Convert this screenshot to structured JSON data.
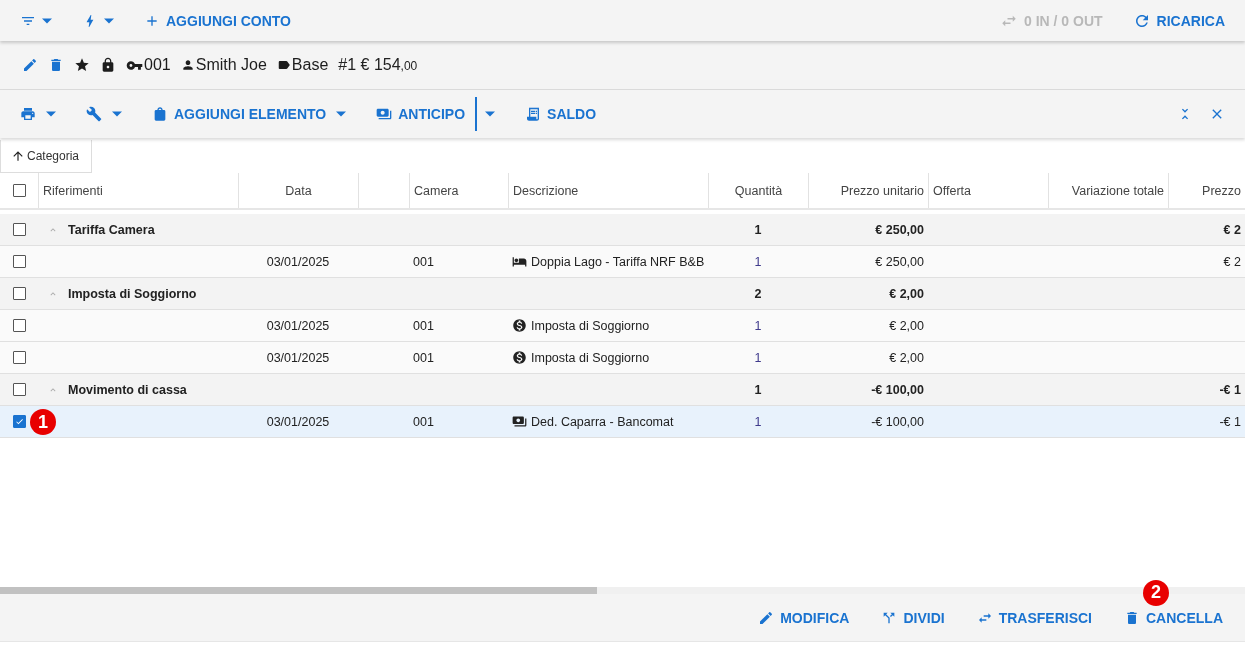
{
  "top_bar": {
    "left": [
      {
        "kind": "filter",
        "caret": true
      },
      {
        "kind": "bolt",
        "caret": true
      },
      {
        "kind": "plus",
        "label": "AGGIUNGI CONTO"
      }
    ],
    "right": [
      {
        "kind": "swap",
        "label": "0 IN / 0 OUT",
        "disabled": true
      },
      {
        "kind": "refresh",
        "label": "RICARICA",
        "disabled": false
      }
    ]
  },
  "info_bar": {
    "actions": [
      {
        "kind": "pencil"
      },
      {
        "kind": "trash"
      }
    ],
    "flags": [
      {
        "kind": "star"
      },
      {
        "kind": "lock"
      }
    ],
    "facts": [
      {
        "kind": "key",
        "text": "001"
      },
      {
        "kind": "person",
        "text": "Smith Joe"
      },
      {
        "kind": "tag",
        "text": "Base"
      }
    ],
    "amount": "#1 € 154",
    "decimals": ",00"
  },
  "toolbar": {
    "left": [
      {
        "kind": "printer",
        "caret": true
      },
      {
        "kind": "wrench",
        "caret": true
      },
      {
        "kind": "bag",
        "label": "AGGIUNGI ELEMENTO",
        "caret": true
      },
      {
        "kind": "money",
        "label": "ANTICIPO",
        "split": true
      },
      {
        "kind": "receipt",
        "label": "SALDO"
      }
    ],
    "right": [
      {
        "kind": "collapse"
      },
      {
        "kind": "close"
      }
    ]
  },
  "grouping": {
    "label": "Categoria"
  },
  "table": {
    "all_checked": false,
    "columns": [
      {
        "label": "Riferimenti"
      },
      {
        "label": "Data"
      },
      {},
      {
        "label": "Camera"
      },
      {
        "label": "Descrizione"
      },
      {
        "label": "Quantità"
      },
      {
        "label": "Prezzo unitario"
      },
      {
        "label": "Offerta"
      },
      {
        "label": "Variazione totale"
      },
      {
        "label": "Prezzo"
      }
    ],
    "rows": [
      {
        "kind": "group",
        "checked": false,
        "expanded": true,
        "label": "Tariffa Camera",
        "quantity": "1",
        "unit_price": "€ 250,00",
        "last": "€ 2"
      },
      {
        "kind": "item",
        "checked": false,
        "date": "03/01/2025",
        "room": "001",
        "description": "Doppia Lago - Tariffa NRF B&B",
        "quantity": "1",
        "unit_price": "€ 250,00",
        "last": "€ 2"
      },
      {
        "kind": "group",
        "checked": false,
        "expanded": true,
        "label": "Imposta di Soggiorno",
        "quantity": "2",
        "unit_price": "€ 2,00"
      },
      {
        "kind": "item",
        "checked": false,
        "date": "03/01/2025",
        "room": "001",
        "description": "Imposta di Soggiorno",
        "quantity": "1",
        "unit_price": "€ 2,00"
      },
      {
        "kind": "item",
        "checked": false,
        "date": "03/01/2025",
        "room": "001",
        "description": "Imposta di Soggiorno",
        "quantity": "1",
        "unit_price": "€ 2,00"
      },
      {
        "kind": "group",
        "checked": false,
        "expanded": true,
        "label": "Movimento di cassa",
        "quantity": "1",
        "unit_price": "-€ 100,00",
        "last": "-€ 1"
      },
      {
        "kind": "item",
        "checked": true,
        "badge": "1",
        "date": "03/01/2025",
        "room": "001",
        "description": "Ded. Caparra - Bancomat",
        "quantity": "1",
        "unit_price": "-€ 100,00",
        "last": "-€ 1"
      }
    ]
  },
  "bottom_bar": [
    {
      "kind": "pencil",
      "label": "MODIFICA"
    },
    {
      "kind": "split",
      "label": "DIVIDI"
    },
    {
      "kind": "swap",
      "label": "TRASFERISCI"
    },
    {
      "kind": "trash",
      "label": "CANCELLA",
      "badge": "2"
    }
  ]
}
